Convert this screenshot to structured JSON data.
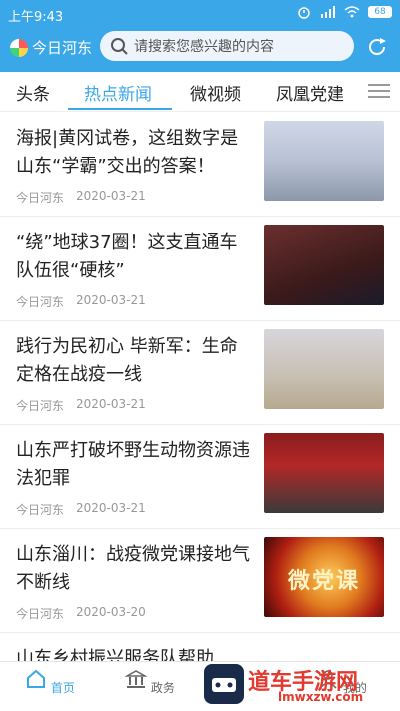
{
  "status_bar": {
    "time": "上午9:43",
    "battery": "68"
  },
  "header": {
    "logo_text": "今日河东",
    "search_placeholder": "请搜索您感兴趣的内容",
    "accent_color": "#3aa7e8"
  },
  "tabs": [
    {
      "label": "头条"
    },
    {
      "label": "热点新闻",
      "active": true
    },
    {
      "label": "微视频"
    },
    {
      "label": "凤凰党建"
    }
  ],
  "feed": [
    {
      "title": "海报|黄冈试卷，这组数字是山东“学霸”交出的答案！",
      "source": "今日河东",
      "date": "2020-03-21"
    },
    {
      "title": "“绕”地球37圈！这支直通车队伍很“硬核”",
      "source": "今日河东",
      "date": "2020-03-21"
    },
    {
      "title": "践行为民初心 毕新军：生命定格在战疫一线",
      "source": "今日河东",
      "date": "2020-03-21"
    },
    {
      "title": "山东严打破坏野生动物资源违法犯罪",
      "source": "今日河东",
      "date": "2020-03-21"
    },
    {
      "title": "山东淄川：战疫微党课接地气不断线",
      "source": "今日河东",
      "date": "2020-03-20"
    },
    {
      "title": "山东乡村振兴服务队帮助",
      "source": "",
      "date": ""
    }
  ],
  "thumb_overlay_text": "微党课",
  "bottom_nav": [
    {
      "label": "首页",
      "active": true
    },
    {
      "label": "政务"
    },
    {
      "label": "我的"
    }
  ],
  "watermark": {
    "brand": "道车手游网",
    "site": "lmwxzw.com"
  }
}
